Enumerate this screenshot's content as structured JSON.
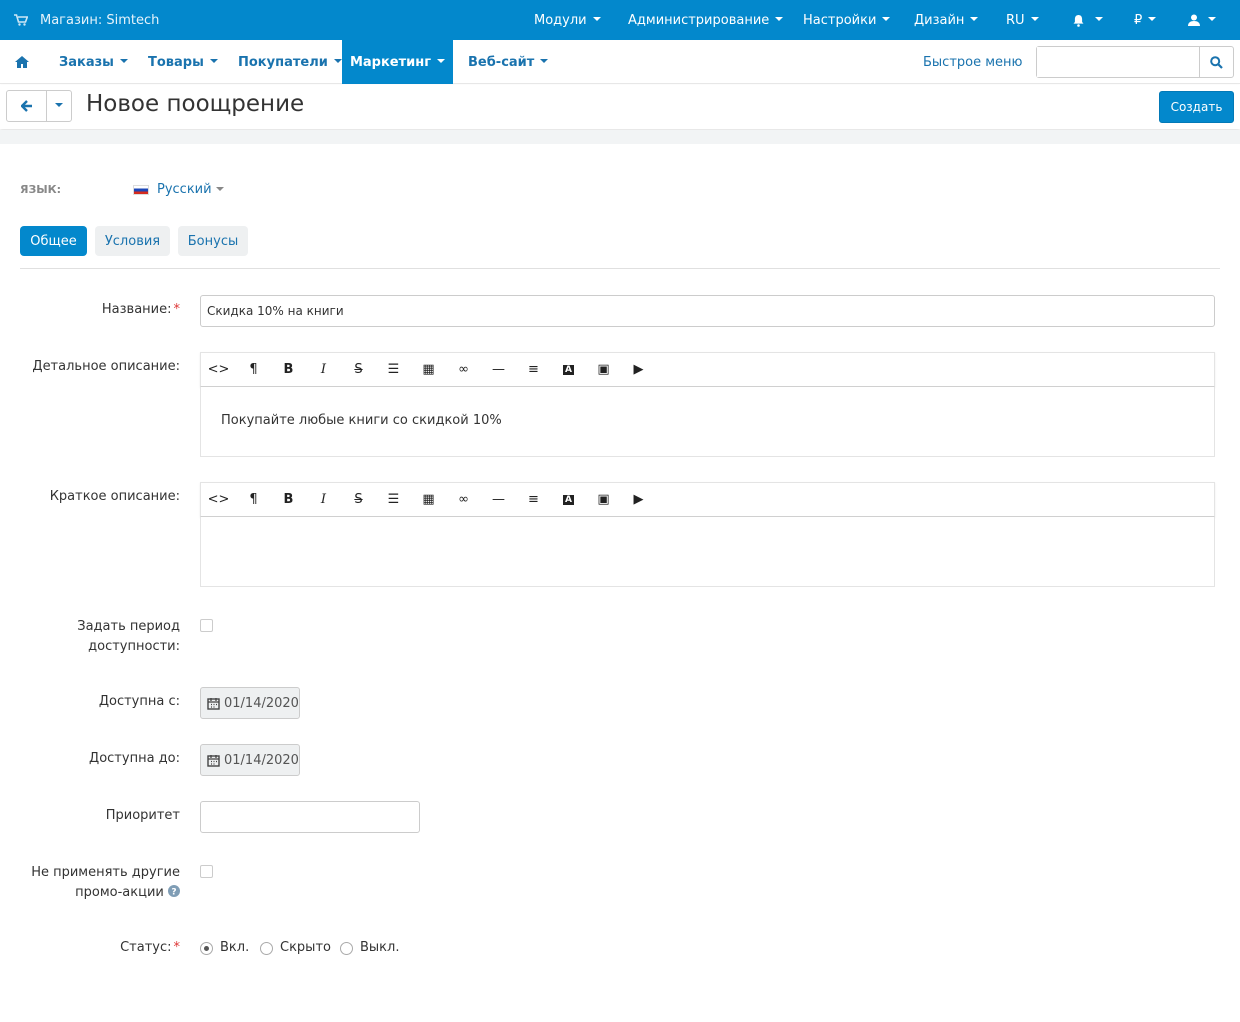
{
  "topbar": {
    "store": "Магазин: Simtech",
    "items": [
      "Модули",
      "Администрирование",
      "Настройки",
      "Дизайн",
      "RU",
      "₽"
    ]
  },
  "mainnav": {
    "items": [
      "Заказы",
      "Товары",
      "Покупатели",
      "Маркетинг",
      "Веб-сайт"
    ],
    "active": "Маркетинг",
    "quick_menu": "Быстрое меню",
    "search_value": ""
  },
  "title": {
    "page_title": "Новое поощрение",
    "create_label": "Создать"
  },
  "language": {
    "label": "ЯЗЫК:",
    "value": "Русский"
  },
  "tabs": [
    "Общее",
    "Условия",
    "Бонусы"
  ],
  "form": {
    "name_label": "Название:",
    "name_value": "Скидка 10% на книги",
    "detail_label": "Детальное описание:",
    "detail_text": "Покупайте любые книги со скидкой 10%",
    "short_label": "Краткое описание:",
    "short_text": "",
    "period_label_1": "Задать период",
    "period_label_2": "доступности:",
    "from_label": "Доступна с:",
    "from_value": "01/14/2020",
    "to_label": "Доступна до:",
    "to_value": "01/14/2020",
    "priority_label": "Приоритет",
    "priority_value": "",
    "exclusive_label_1": "Не применять другие",
    "exclusive_label_2": "промо-акции",
    "status_label": "Статус:",
    "status_options": [
      "Вкл.",
      "Скрыто",
      "Выкл."
    ],
    "status_selected": "Вкл."
  },
  "colors": {
    "brand": "#0388cc",
    "link": "#1a73ae"
  }
}
